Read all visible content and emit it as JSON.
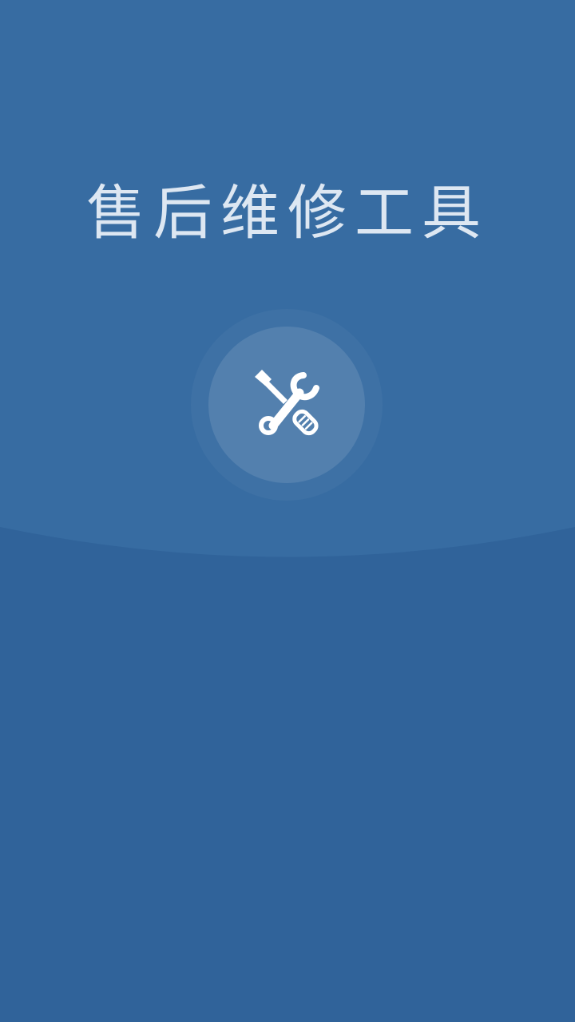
{
  "app": {
    "title": "售后维修工具"
  },
  "logo": {
    "icon": "tools-icon"
  },
  "colors": {
    "background_top": "#376CA2",
    "background_bottom": "#30639A",
    "title_text": "#E6EEF7",
    "icon": "#FFFFFF"
  }
}
